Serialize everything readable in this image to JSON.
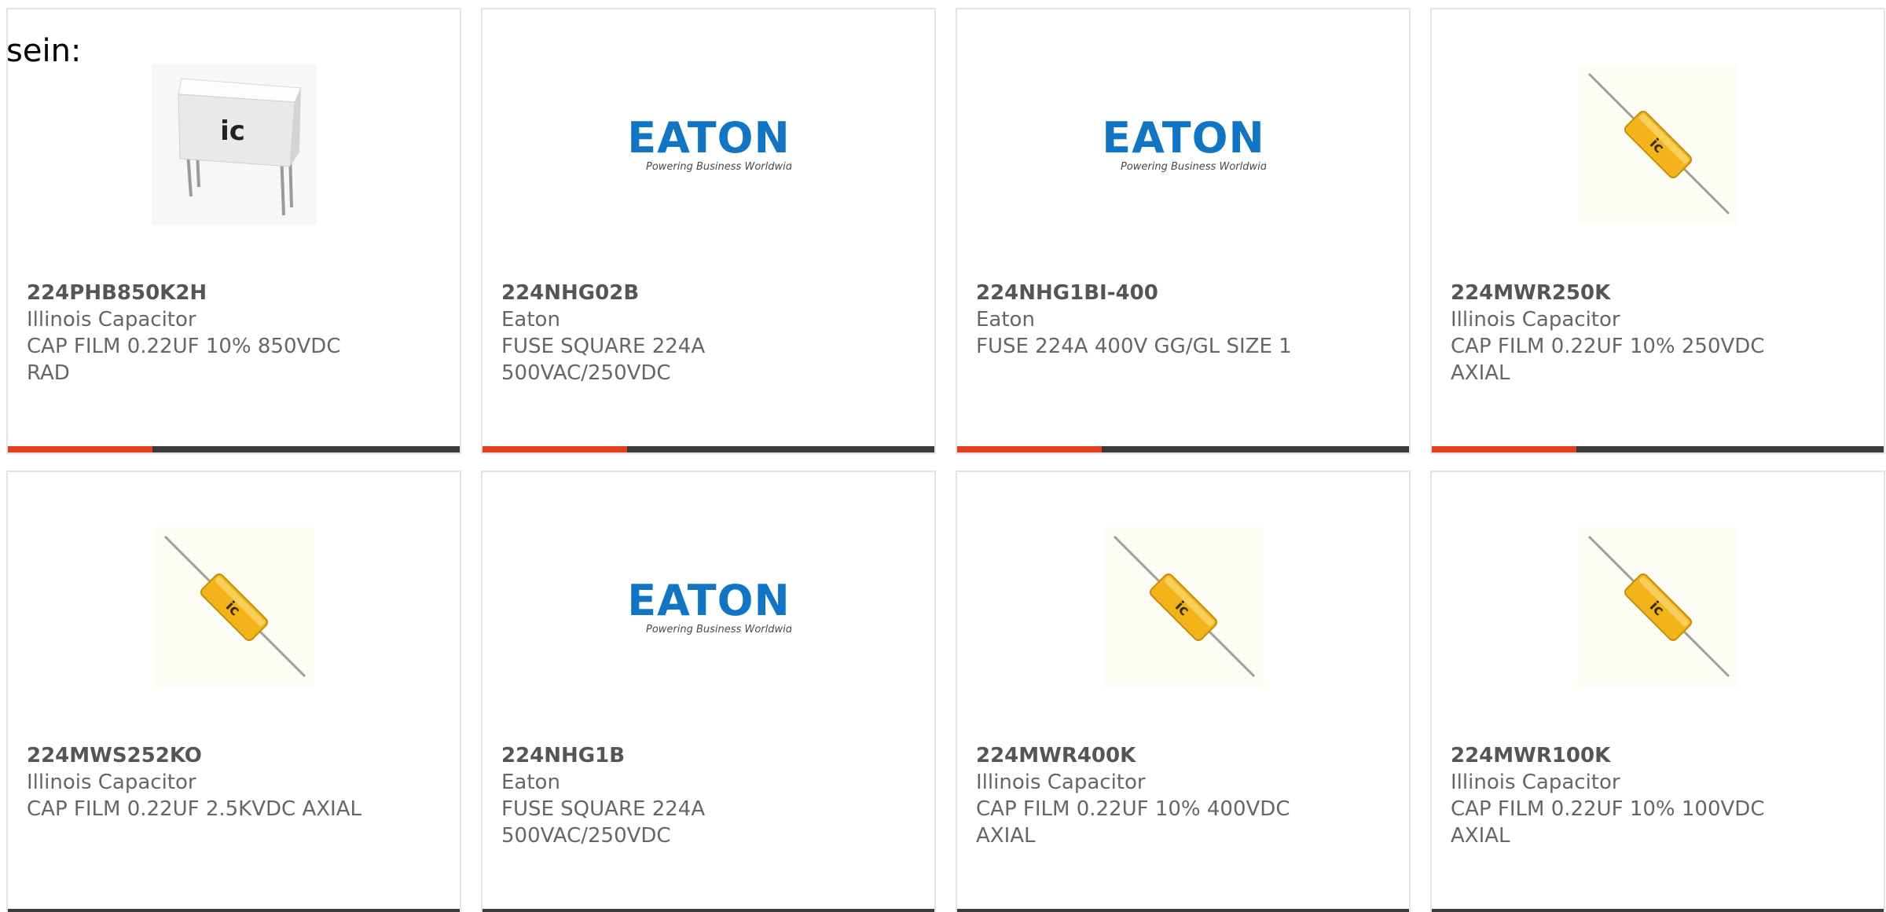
{
  "intro_text": "sein:",
  "colors": {
    "accent": "#e2401c",
    "bar": "#3b3b3b",
    "eaton_blue": "#1175c5",
    "capacitor_yellow": "#f2b418"
  },
  "products": [
    {
      "part_number": "224PHB850K2H",
      "manufacturer": "Illinois Capacitor",
      "description": "CAP FILM 0.22UF 10% 850VDC RAD",
      "image": "radial-film-capacitor-image",
      "accent_fraction": 0.32,
      "logo": {
        "brand": "ic"
      }
    },
    {
      "part_number": "224NHG02B",
      "manufacturer": "Eaton",
      "description": "FUSE SQUARE 224A 500VAC/250VDC",
      "image": "eaton-logo-image",
      "accent_fraction": 0.32,
      "logo": {
        "brand": "EATON",
        "tagline": "Powering Business Worldwide"
      }
    },
    {
      "part_number": "224NHG1BI-400",
      "manufacturer": "Eaton",
      "description": "FUSE 224A 400V GG/GL SIZE 1",
      "image": "eaton-logo-image",
      "accent_fraction": 0.32,
      "logo": {
        "brand": "EATON",
        "tagline": "Powering Business Worldwide"
      }
    },
    {
      "part_number": "224MWR250K",
      "manufacturer": "Illinois Capacitor",
      "description": "CAP FILM 0.22UF 10% 250VDC AXIAL",
      "image": "axial-capacitor-image",
      "accent_fraction": 0.32,
      "logo": {
        "brand": "ic"
      }
    },
    {
      "part_number": "224MWS252KO",
      "manufacturer": "Illinois Capacitor",
      "description": "CAP FILM 0.22UF 2.5KVDC AXIAL",
      "image": "axial-capacitor-image",
      "accent_fraction": 0,
      "logo": {
        "brand": "ic"
      }
    },
    {
      "part_number": "224NHG1B",
      "manufacturer": "Eaton",
      "description": "FUSE SQUARE 224A 500VAC/250VDC",
      "image": "eaton-logo-image",
      "accent_fraction": 0,
      "logo": {
        "brand": "EATON",
        "tagline": "Powering Business Worldwide"
      }
    },
    {
      "part_number": "224MWR400K",
      "manufacturer": "Illinois Capacitor",
      "description": "CAP FILM 0.22UF 10% 400VDC AXIAL",
      "image": "axial-capacitor-image",
      "accent_fraction": 0,
      "logo": {
        "brand": "ic"
      }
    },
    {
      "part_number": "224MWR100K",
      "manufacturer": "Illinois Capacitor",
      "description": "CAP FILM 0.22UF 10% 100VDC AXIAL",
      "image": "axial-capacitor-image",
      "accent_fraction": 0,
      "logo": {
        "brand": "ic"
      }
    }
  ]
}
